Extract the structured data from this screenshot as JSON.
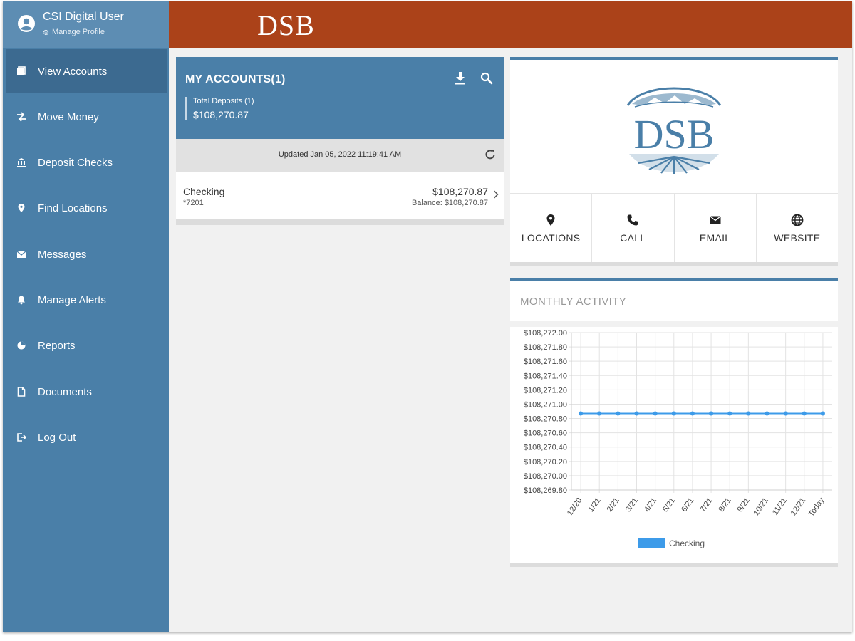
{
  "profile": {
    "name": "CSI Digital User",
    "manage_label": "Manage Profile"
  },
  "sidebar": {
    "items": [
      {
        "label": "View Accounts",
        "icon": "accounts-icon",
        "active": true
      },
      {
        "label": "Move Money",
        "icon": "transfer-icon"
      },
      {
        "label": "Deposit Checks",
        "icon": "bank-icon"
      },
      {
        "label": "Find Locations",
        "icon": "location-pin-icon"
      },
      {
        "label": "Messages",
        "icon": "envelope-icon"
      },
      {
        "label": "Manage Alerts",
        "icon": "bell-icon"
      },
      {
        "label": "Reports",
        "icon": "pie-chart-icon"
      },
      {
        "label": "Documents",
        "icon": "document-icon"
      },
      {
        "label": "Log Out",
        "icon": "logout-icon"
      }
    ]
  },
  "header": {
    "logo_text": "DSB",
    "color": "#ab4219"
  },
  "accounts": {
    "title": "MY ACCOUNTS(1)",
    "total_label": "Total Deposits (1)",
    "total_value": "$108,270.87",
    "updated": "Updated Jan 05, 2022 11:19:41 AM",
    "rows": [
      {
        "name": "Checking",
        "number": "*7201",
        "amount": "$108,270.87",
        "balance": "Balance: $108,270.87"
      }
    ]
  },
  "bank": {
    "logo_text": "DSB"
  },
  "contact": [
    {
      "label": "LOCATIONS",
      "icon": "location-pin-icon"
    },
    {
      "label": "CALL",
      "icon": "phone-icon"
    },
    {
      "label": "EMAIL",
      "icon": "envelope-icon"
    },
    {
      "label": "WEBSITE",
      "icon": "globe-icon"
    }
  ],
  "activity": {
    "title": "MONTHLY ACTIVITY"
  },
  "colors": {
    "primary": "#4a7fa8",
    "header": "#ab4219",
    "series": "#3d9be9"
  },
  "chart_data": {
    "type": "line",
    "categories": [
      "12/20",
      "1/21",
      "2/21",
      "3/21",
      "4/21",
      "5/21",
      "6/21",
      "7/21",
      "8/21",
      "9/21",
      "10/21",
      "11/21",
      "12/21",
      "Today"
    ],
    "series": [
      {
        "name": "Checking",
        "values": [
          108270.87,
          108270.87,
          108270.87,
          108270.87,
          108270.87,
          108270.87,
          108270.87,
          108270.87,
          108270.87,
          108270.87,
          108270.87,
          108270.87,
          108270.87,
          108270.87
        ]
      }
    ],
    "yticks": [
      "$108,272.00",
      "$108,271.80",
      "$108,271.60",
      "$108,271.40",
      "$108,271.20",
      "$108,271.00",
      "$108,270.80",
      "$108,270.60",
      "$108,270.40",
      "$108,270.20",
      "$108,270.00",
      "$108,269.80"
    ],
    "ylim": [
      108269.8,
      108272.0
    ],
    "grid": true,
    "legend": "bottom"
  }
}
